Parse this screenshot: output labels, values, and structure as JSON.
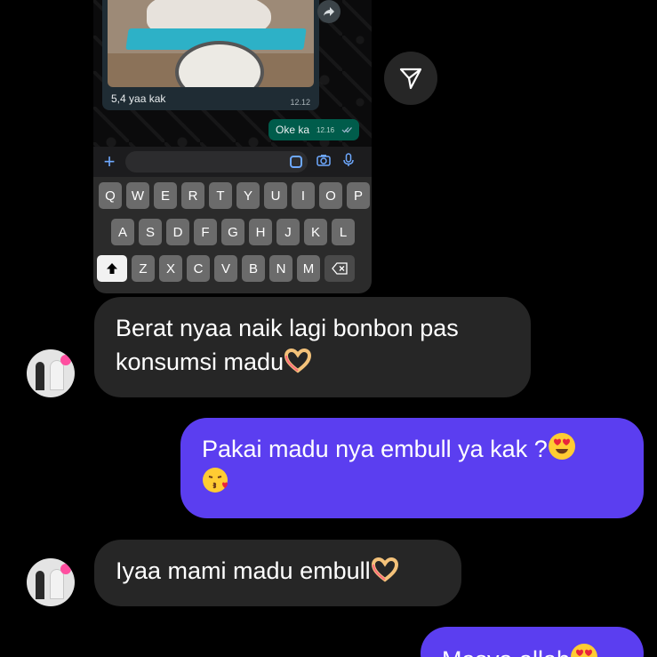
{
  "embedded_chat": {
    "photo_caption": "5,4 yaa kak",
    "photo_time": "12.12",
    "outgoing_text": "Oke ka",
    "outgoing_time": "12.16",
    "keyboard_rows": [
      [
        "Q",
        "W",
        "E",
        "R",
        "T",
        "Y",
        "U",
        "I",
        "O",
        "P"
      ],
      [
        "A",
        "S",
        "D",
        "F",
        "G",
        "H",
        "J",
        "K",
        "L"
      ],
      [
        "Z",
        "X",
        "C",
        "V",
        "B",
        "N",
        "M"
      ]
    ]
  },
  "thread": {
    "messages": [
      {
        "side": "in",
        "text": "Berat nyaa naik lagi bonbon pas konsumsi madu",
        "emoji": "heart-hands"
      },
      {
        "side": "out",
        "text": "Pakai madu nya embull ya kak ?",
        "emoji": "heart-eyes, kissing-heart"
      },
      {
        "side": "in",
        "text": "Iyaa mami madu embull",
        "emoji": "heart-hands"
      },
      {
        "side": "out",
        "text": "Masya allah",
        "emoji": "heart-eyes"
      }
    ]
  },
  "colors": {
    "incoming_bubble": "#262626",
    "outgoing_bubble": "#5b3ef0",
    "wa_outgoing": "#005c4b",
    "background": "#000000"
  },
  "icons": [
    "share-forward-icon",
    "send-icon",
    "plus-icon",
    "sticker-icon",
    "camera-icon",
    "microphone-icon",
    "shift-icon",
    "backspace-icon",
    "heart-hands-icon",
    "heart-eyes-icon",
    "kissing-heart-icon"
  ]
}
